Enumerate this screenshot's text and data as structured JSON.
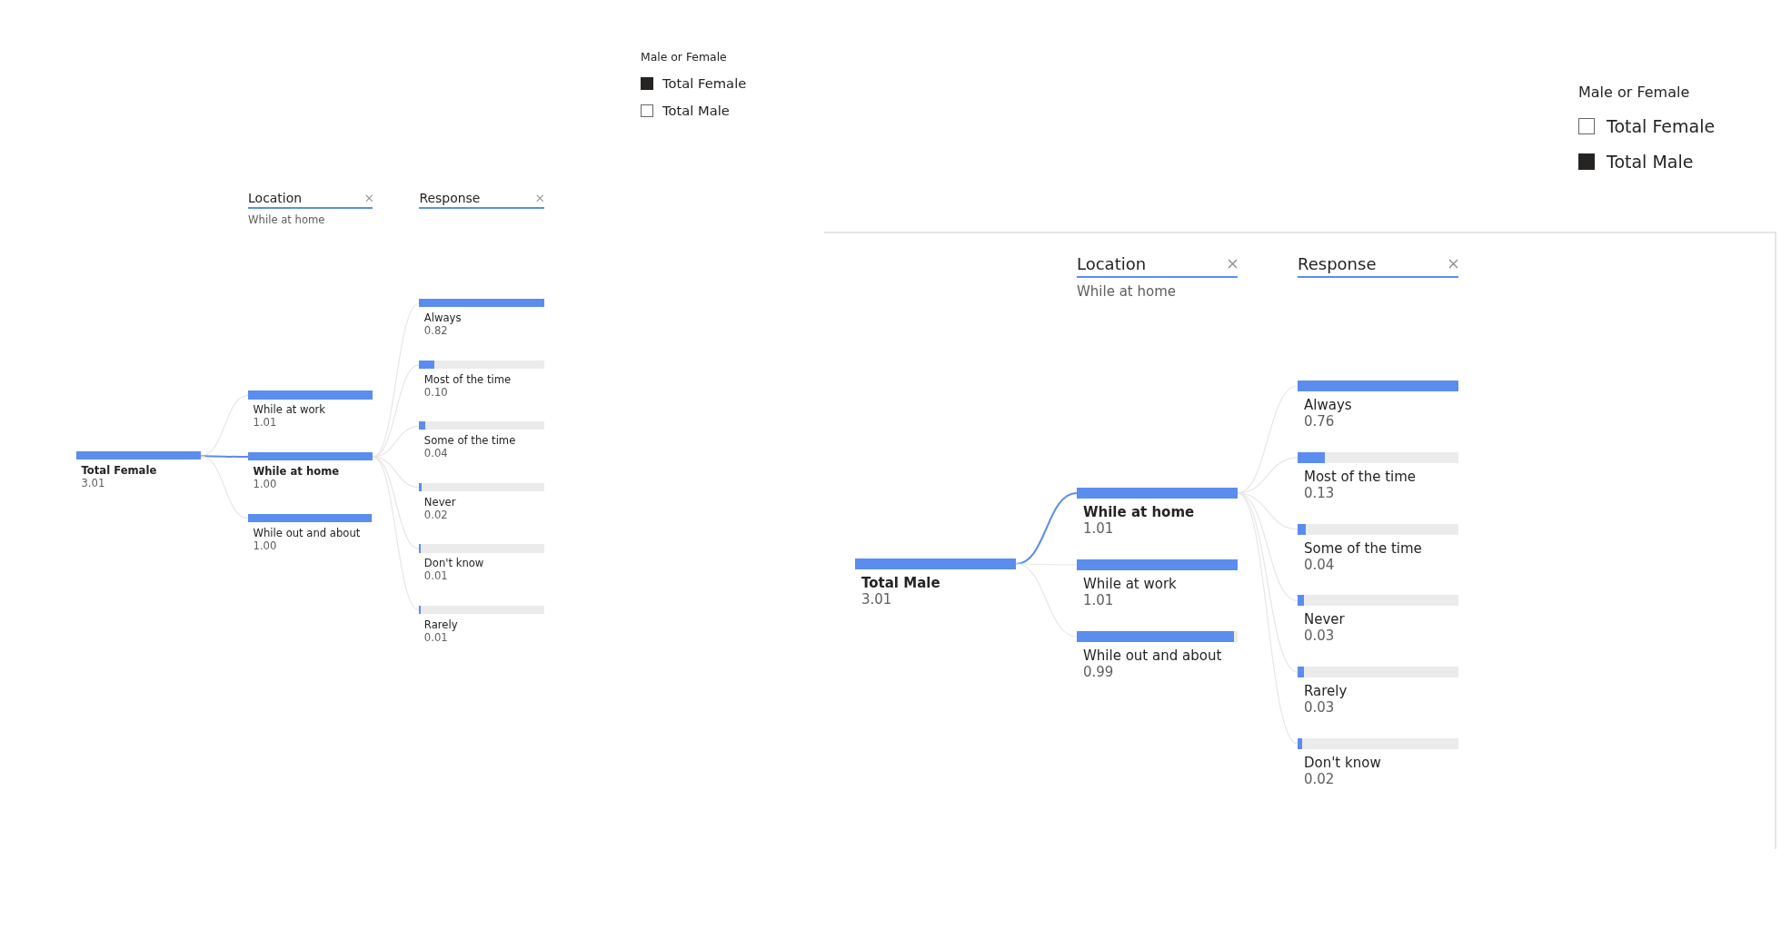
{
  "panels": [
    {
      "bordered": false,
      "legend": {
        "title": "Male or Female",
        "items": [
          {
            "label": "Total Female",
            "checked": true
          },
          {
            "label": "Total Male",
            "checked": false
          }
        ]
      },
      "tree": {
        "root": {
          "label": "Total Female",
          "value": "3.01",
          "level": 1
        },
        "columns": [
          {
            "header": "Location",
            "subtitle": "While at home",
            "nodes": [
              {
                "label": "While at work",
                "value": "1.01",
                "level": 1,
                "selected": false
              },
              {
                "label": "While at home",
                "value": "1.00",
                "level": 1,
                "selected": true
              },
              {
                "label": "While out and about",
                "value": "1.00",
                "level": 0.99,
                "selected": false
              }
            ]
          },
          {
            "header": "Response",
            "nodes": [
              {
                "label": "Always",
                "value": "0.82",
                "level": 1,
                "selected": false
              },
              {
                "label": "Most of the time",
                "value": "0.10",
                "level": 0.12,
                "selected": false
              },
              {
                "label": "Some of the time",
                "value": "0.04",
                "level": 0.05,
                "selected": false
              },
              {
                "label": "Never",
                "value": "0.02",
                "level": 0.02,
                "selected": false
              },
              {
                "label": "Don't know",
                "value": "0.01",
                "level": 0.01,
                "selected": false
              },
              {
                "label": "Rarely",
                "value": "0.01",
                "level": 0.01,
                "selected": false
              }
            ]
          }
        ]
      }
    },
    {
      "bordered": true,
      "legend": {
        "title": "Male or Female",
        "items": [
          {
            "label": "Total Female",
            "checked": false
          },
          {
            "label": "Total Male",
            "checked": true
          }
        ]
      },
      "tree": {
        "root": {
          "label": "Total Male",
          "value": "3.01",
          "level": 1
        },
        "columns": [
          {
            "header": "Location",
            "subtitle": "While at home",
            "nodes": [
              {
                "label": "While at home",
                "value": "1.01",
                "level": 1,
                "selected": true
              },
              {
                "label": "While at work",
                "value": "1.01",
                "level": 1,
                "selected": false
              },
              {
                "label": "While out and about",
                "value": "0.99",
                "level": 0.98,
                "selected": false
              }
            ]
          },
          {
            "header": "Response",
            "nodes": [
              {
                "label": "Always",
                "value": "0.76",
                "level": 1,
                "selected": false
              },
              {
                "label": "Most of the time",
                "value": "0.13",
                "level": 0.17,
                "selected": false
              },
              {
                "label": "Some of the time",
                "value": "0.04",
                "level": 0.05,
                "selected": false
              },
              {
                "label": "Never",
                "value": "0.03",
                "level": 0.04,
                "selected": false
              },
              {
                "label": "Rarely",
                "value": "0.03",
                "level": 0.04,
                "selected": false
              },
              {
                "label": "Don't know",
                "value": "0.02",
                "level": 0.03,
                "selected": false
              }
            ]
          }
        ]
      }
    }
  ]
}
